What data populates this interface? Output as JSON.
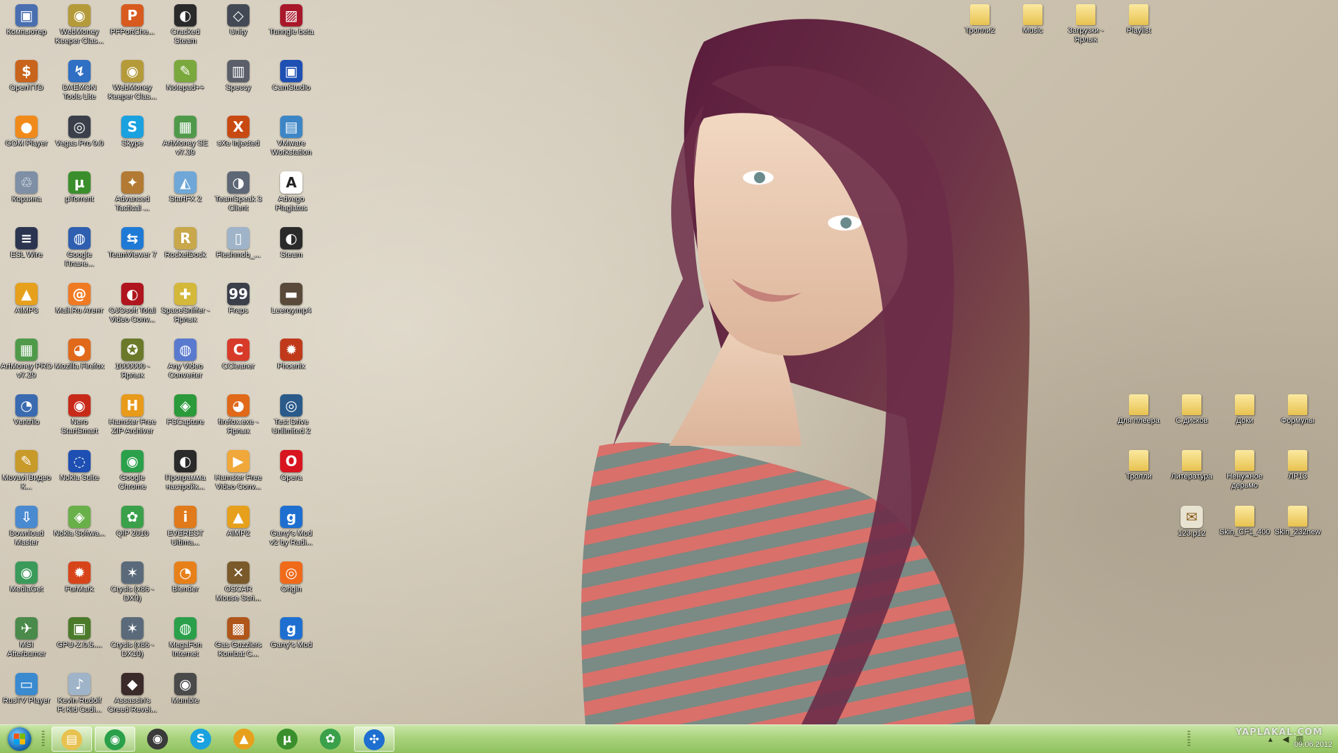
{
  "desktop_icons_left": [
    {
      "label": "Компьютер",
      "icon": "computer-icon",
      "color": "#4a6fb0",
      "glyph": "▣"
    },
    {
      "label": "WebMoney Keeper Clas...",
      "icon": "webmoney-icon",
      "color": "#b59a3a",
      "glyph": "◉"
    },
    {
      "label": "PFPortChe...",
      "icon": "pfportcheck-icon",
      "color": "#d85a1e",
      "glyph": "P"
    },
    {
      "label": "Cracked Steam",
      "icon": "steam-icon",
      "color": "#2a2a2a",
      "glyph": "◐"
    },
    {
      "label": "Unity",
      "icon": "unity-icon",
      "color": "#444a55",
      "glyph": "◇"
    },
    {
      "label": "Tunngle beta",
      "icon": "tunngle-icon",
      "color": "#a8172a",
      "glyph": "▨"
    },
    {
      "label": "OpenTTD",
      "icon": "openttd-icon",
      "color": "#c8641c",
      "glyph": "$"
    },
    {
      "label": "DAEMON Tools Lite",
      "icon": "daemon-tools-icon",
      "color": "#2f6fc4",
      "glyph": "↯"
    },
    {
      "label": "WebMoney Keeper Clas...",
      "icon": "webmoney-icon",
      "color": "#b59a3a",
      "glyph": "◉"
    },
    {
      "label": "Notepad++",
      "icon": "notepad-plus-icon",
      "color": "#7aa83c",
      "glyph": "✎"
    },
    {
      "label": "Speccy",
      "icon": "speccy-icon",
      "color": "#5a5f6a",
      "glyph": "▥"
    },
    {
      "label": "CamStudio",
      "icon": "camstudio-icon",
      "color": "#1e4fb3",
      "glyph": "▣"
    },
    {
      "label": "GOM Player",
      "icon": "gom-player-icon",
      "color": "#f08a1a",
      "glyph": "●"
    },
    {
      "label": "Vegas Pro 9.0",
      "icon": "vegas-icon",
      "color": "#3a3f4a",
      "glyph": "◎"
    },
    {
      "label": "Skype",
      "icon": "skype-icon",
      "color": "#1aa1e0",
      "glyph": "S"
    },
    {
      "label": "ArtMoney SE v7.39",
      "icon": "artmoney-icon",
      "color": "#4f9a4a",
      "glyph": "▦"
    },
    {
      "label": "sXe Injected",
      "icon": "sxe-icon",
      "color": "#c84a12",
      "glyph": "X"
    },
    {
      "label": "VMware Workstation",
      "icon": "vmware-icon",
      "color": "#3d86c6",
      "glyph": "▤"
    },
    {
      "label": "Корзина",
      "icon": "recycle-bin-icon",
      "color": "#7e8fa6",
      "glyph": "♲"
    },
    {
      "label": "µTorrent",
      "icon": "utorrent-icon",
      "color": "#3a8f2c",
      "glyph": "µ"
    },
    {
      "label": "Advanced Tactical ...",
      "icon": "atf-icon",
      "color": "#b27a32",
      "glyph": "✦"
    },
    {
      "label": "StartFX 2",
      "icon": "startfx-icon",
      "color": "#6fa8d8",
      "glyph": "◭"
    },
    {
      "label": "TeamSpeak 3 Client",
      "icon": "teamspeak-icon",
      "color": "#5d6775",
      "glyph": "◑"
    },
    {
      "label": "Advego Plagiatus",
      "icon": "advego-icon",
      "color": "#ffffff",
      "glyph": "A"
    },
    {
      "label": "ESL Wire",
      "icon": "esl-wire-icon",
      "color": "#2b3550",
      "glyph": "≡"
    },
    {
      "label": "Google Плане...",
      "icon": "google-earth-icon",
      "color": "#2e5fb0",
      "glyph": "◍"
    },
    {
      "label": "TeamViewer 7",
      "icon": "teamviewer-icon",
      "color": "#1f7ad6",
      "glyph": "⇆"
    },
    {
      "label": "RocketDock",
      "icon": "rocketdock-icon",
      "color": "#c8a84a",
      "glyph": "R"
    },
    {
      "label": "Fleshmob_...",
      "icon": "file-icon",
      "color": "#9fb4c8",
      "glyph": "▯"
    },
    {
      "label": "Steam",
      "icon": "steam-icon",
      "color": "#2a2a2a",
      "glyph": "◐"
    },
    {
      "label": "AIMP3",
      "icon": "aimp-icon",
      "color": "#e6a01c",
      "glyph": "▲"
    },
    {
      "label": "Mail.Ru Агент",
      "icon": "mailru-agent-icon",
      "color": "#f07a22",
      "glyph": "@"
    },
    {
      "label": "OJOsoft Total Video Conv...",
      "icon": "ojosoft-icon",
      "color": "#b0141e",
      "glyph": "◐"
    },
    {
      "label": "SpaceSniffer - Ярлык",
      "icon": "spacesniffer-icon",
      "color": "#d4b83a",
      "glyph": "✚"
    },
    {
      "label": "Fraps",
      "icon": "fraps-icon",
      "color": "#3a3f4a",
      "glyph": "99"
    },
    {
      "label": "Leeroy.mp4",
      "icon": "video-file-icon",
      "color": "#5a4a3a",
      "glyph": "▬"
    },
    {
      "label": "ArtMoney PRO v7.29",
      "icon": "artmoney-icon",
      "color": "#4f9a4a",
      "glyph": "▦"
    },
    {
      "label": "Mozilla Firefox",
      "icon": "firefox-icon",
      "color": "#e0691a",
      "glyph": "◕"
    },
    {
      "label": "1000000 - Ярлык",
      "icon": "shortcut-icon",
      "color": "#6a7a2a",
      "glyph": "✪"
    },
    {
      "label": "Any Video Converter",
      "icon": "any-video-converter-icon",
      "color": "#5a7ad0",
      "glyph": "◍"
    },
    {
      "label": "CCleaner",
      "icon": "ccleaner-icon",
      "color": "#d83a2a",
      "glyph": "C"
    },
    {
      "label": "Phoenix",
      "icon": "phoenix-icon",
      "color": "#c0391a",
      "glyph": "✹"
    },
    {
      "label": "Ventrilo",
      "icon": "ventrilo-icon",
      "color": "#3a6ab0",
      "glyph": "◔"
    },
    {
      "label": "Nero StartSmart",
      "icon": "nero-icon",
      "color": "#c82a1a",
      "glyph": "◉"
    },
    {
      "label": "Hamster Free ZIP Archiver",
      "icon": "hamster-zip-icon",
      "color": "#e89a1a",
      "glyph": "H"
    },
    {
      "label": "FSCapture",
      "icon": "fscapture-icon",
      "color": "#2a9a3a",
      "glyph": "◈"
    },
    {
      "label": "firefox.exe - Ярлык",
      "icon": "firefox-icon",
      "color": "#e0691a",
      "glyph": "◕"
    },
    {
      "label": "Test Drive Unlimited 2",
      "icon": "tdu2-icon",
      "color": "#2a5a8a",
      "glyph": "◎"
    },
    {
      "label": "Movavi Видео К...",
      "icon": "movavi-icon",
      "color": "#c89a2a",
      "glyph": "✎"
    },
    {
      "label": "Nokia Suite",
      "icon": "nokia-suite-icon",
      "color": "#1e4fb3",
      "glyph": "◌"
    },
    {
      "label": "Google Chrome",
      "icon": "chrome-icon",
      "color": "#2aa04a",
      "glyph": "◉"
    },
    {
      "label": "Программа настройк...",
      "icon": "steam-icon",
      "color": "#2a2a2a",
      "glyph": "◐"
    },
    {
      "label": "Hamster Free Video Conv...",
      "icon": "hamster-video-icon",
      "color": "#f0a83a",
      "glyph": "▶"
    },
    {
      "label": "Opera",
      "icon": "opera-icon",
      "color": "#d8141e",
      "glyph": "O"
    },
    {
      "label": "Download Master",
      "icon": "download-master-icon",
      "color": "#4a8ad0",
      "glyph": "⇩"
    },
    {
      "label": "Nokia Softwa...",
      "icon": "nokia-software-icon",
      "color": "#6ab04a",
      "glyph": "◈"
    },
    {
      "label": "QIP 2010",
      "icon": "qip-icon",
      "color": "#3aa04a",
      "glyph": "✿"
    },
    {
      "label": "EVEREST Ultima...",
      "icon": "everest-icon",
      "color": "#e07a1a",
      "glyph": "i"
    },
    {
      "label": "AIMP2",
      "icon": "aimp-icon",
      "color": "#e6a01c",
      "glyph": "▲"
    },
    {
      "label": "Garry's Mod v2 by Radi...",
      "icon": "garrys-mod-icon",
      "color": "#1e6fd0",
      "glyph": "g"
    },
    {
      "label": "MediaGet",
      "icon": "mediaget-icon",
      "color": "#3a9a5a",
      "glyph": "◉"
    },
    {
      "label": "FurMark",
      "icon": "furmark-icon",
      "color": "#d8441a",
      "glyph": "✹"
    },
    {
      "label": "Crysis (x86 -DX9)",
      "icon": "crysis-icon",
      "color": "#5a6a7a",
      "glyph": "✶"
    },
    {
      "label": "Blender",
      "icon": "blender-icon",
      "color": "#e8801a",
      "glyph": "◔"
    },
    {
      "label": "OSCAR Mouse Scri...",
      "icon": "oscar-icon",
      "color": "#7a5a2a",
      "glyph": "✕"
    },
    {
      "label": "Origin",
      "icon": "origin-icon",
      "color": "#f06a1a",
      "glyph": "◎"
    },
    {
      "label": "MSI Afterburner",
      "icon": "msi-afterburner-icon",
      "color": "#4a8a4a",
      "glyph": "✈"
    },
    {
      "label": "GPU-Z.0.5....",
      "icon": "gpuz-icon",
      "color": "#4a7a2a",
      "glyph": "▣"
    },
    {
      "label": "Crysis (x86 -DX10)",
      "icon": "crysis-icon",
      "color": "#5a6a7a",
      "glyph": "✶"
    },
    {
      "label": "MegaFon Internet",
      "icon": "megafon-icon",
      "color": "#2aa04a",
      "glyph": "◍"
    },
    {
      "label": "Gas Guzzlers Kombat C...",
      "icon": "gas-guzzlers-icon",
      "color": "#b0561a",
      "glyph": "▩"
    },
    {
      "label": "Garry's Mod",
      "icon": "garrys-mod-icon",
      "color": "#1e6fd0",
      "glyph": "g"
    },
    {
      "label": "RusTV Player",
      "icon": "rustv-icon",
      "color": "#3a8ad0",
      "glyph": "▭"
    },
    {
      "label": "Kevin Rudolf Ft Kid Cudi...",
      "icon": "audio-file-icon",
      "color": "#9fb4c8",
      "glyph": "♪"
    },
    {
      "label": "Assassin's Creed Revel...",
      "icon": "assassins-creed-icon",
      "color": "#3a2a2a",
      "glyph": "◆"
    },
    {
      "label": "Mumble",
      "icon": "mumble-icon",
      "color": "#4a4a4a",
      "glyph": "◉"
    }
  ],
  "desktop_icons_topright": [
    {
      "label": "Тролли2",
      "icon": "folder-icon"
    },
    {
      "label": "Music",
      "icon": "folder-icon"
    },
    {
      "label": "Загрузки - Ярлык",
      "icon": "folder-shortcut-icon"
    },
    {
      "label": "Playlist",
      "icon": "folder-icon"
    }
  ],
  "desktop_icons_right": [
    {
      "label": "Для плеера",
      "icon": "folder-icon"
    },
    {
      "label": "С дисков",
      "icon": "folder-icon"
    },
    {
      "label": "Доки",
      "icon": "folder-icon"
    },
    {
      "label": "Формулы",
      "icon": "folder-icon"
    },
    {
      "label": "Тролли",
      "icon": "folder-icon"
    },
    {
      "label": "Литература",
      "icon": "folder-icon"
    },
    {
      "label": "Ненужное дерьмо",
      "icon": "folder-icon"
    },
    {
      "label": "ЛР13",
      "icon": "folder-icon"
    },
    {
      "label": "123.p12",
      "icon": "certificate-file-icon"
    },
    {
      "label": "Skin_CF1_400",
      "icon": "folder-icon"
    },
    {
      "label": "Skin_232new",
      "icon": "folder-icon"
    }
  ],
  "taskbar": {
    "pinned": [
      {
        "name": "explorer",
        "icon": "explorer-folder-icon",
        "color": "#e8c250",
        "glyph": "▤",
        "active": true
      },
      {
        "name": "chrome",
        "icon": "chrome-icon",
        "color": "#2aa04a",
        "glyph": "◉",
        "active": true
      },
      {
        "name": "mumble",
        "icon": "mumble-icon",
        "color": "#3a3a3a",
        "glyph": "◉",
        "active": false
      },
      {
        "name": "skype",
        "icon": "skype-icon",
        "color": "#1aa1e0",
        "glyph": "S",
        "active": false
      },
      {
        "name": "aimp",
        "icon": "aimp-icon",
        "color": "#e6a01c",
        "glyph": "▲",
        "active": false
      },
      {
        "name": "utorrent",
        "icon": "utorrent-icon",
        "color": "#3a8f2c",
        "glyph": "µ",
        "active": false
      },
      {
        "name": "qip",
        "icon": "qip-icon",
        "color": "#3aa04a",
        "glyph": "✿",
        "active": false
      },
      {
        "name": "rocketdock",
        "icon": "rocketdock-icon",
        "color": "#1e6fd0",
        "glyph": "✣",
        "active": true
      }
    ],
    "clock_date": "09.06.2012",
    "watermark": "YAPLAKAL.COM"
  }
}
